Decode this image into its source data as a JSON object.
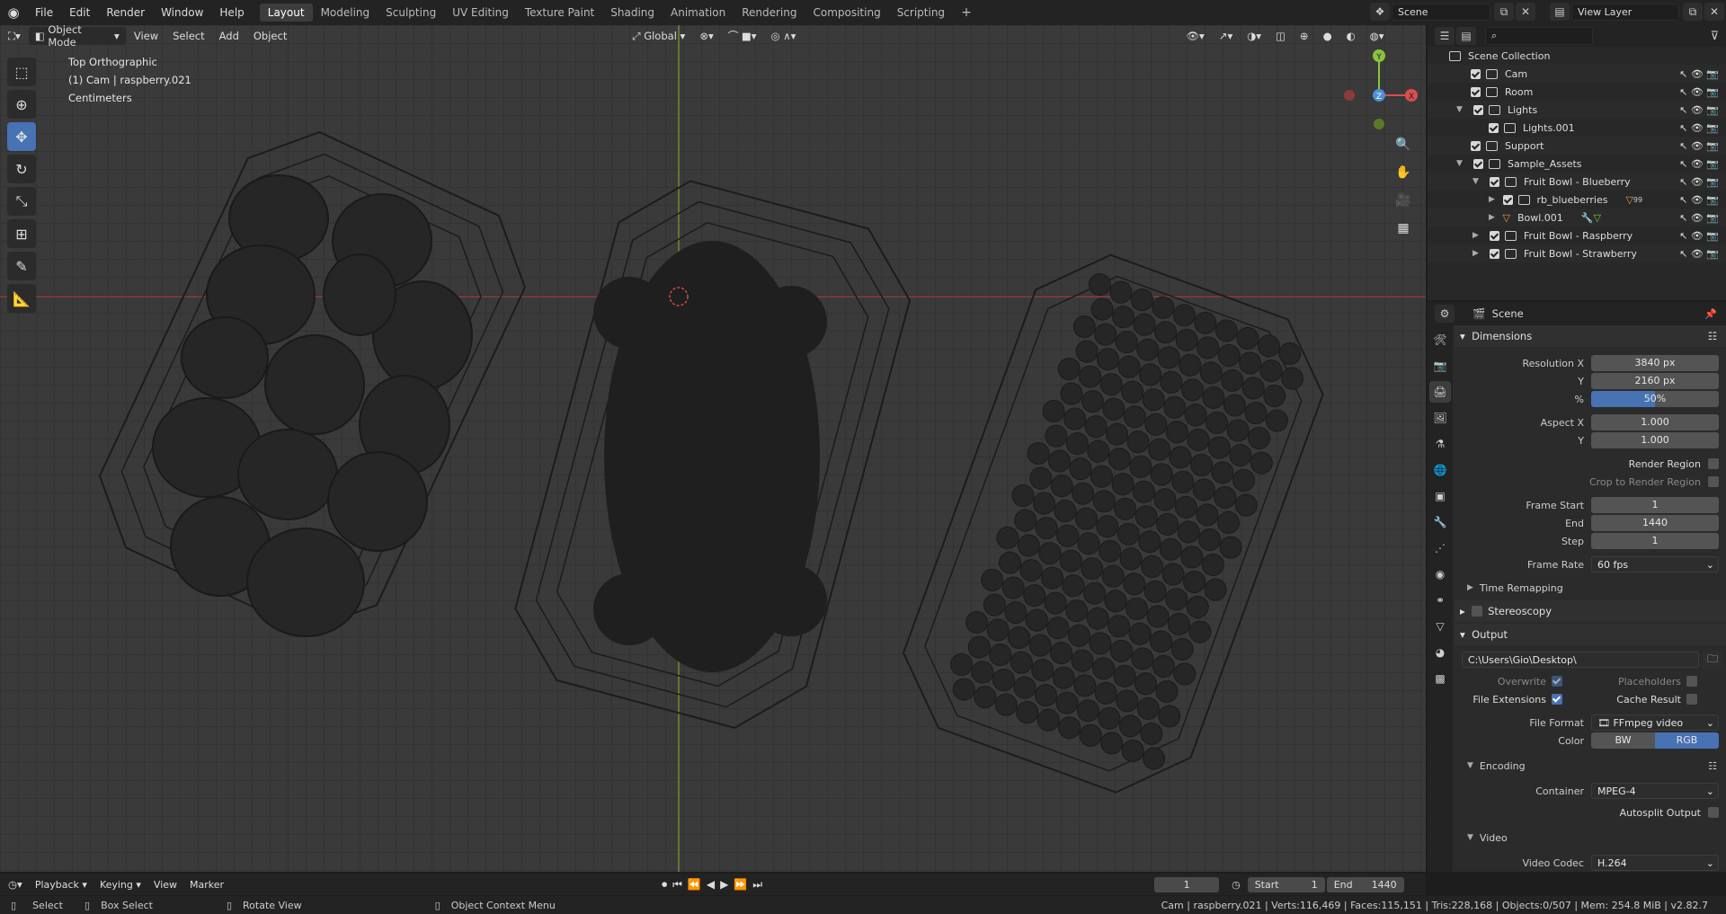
{
  "menu": [
    "File",
    "Edit",
    "Render",
    "Window",
    "Help"
  ],
  "workspaces": [
    "Layout",
    "Modeling",
    "Sculpting",
    "UV Editing",
    "Texture Paint",
    "Shading",
    "Animation",
    "Rendering",
    "Compositing",
    "Scripting"
  ],
  "scene_name": "Scene",
  "view_layer": "View Layer",
  "viewport": {
    "mode": "Object Mode",
    "menus": [
      "View",
      "Select",
      "Add",
      "Object"
    ],
    "transform_orientation": "Global",
    "info": [
      "Top Orthographic",
      "(1) Cam | raspberry.021",
      "Centimeters"
    ]
  },
  "gizmo": {
    "y": "Y",
    "x": "X",
    "z": "Z"
  },
  "outliner": {
    "rows": [
      {
        "label": "Scene Collection"
      },
      {
        "label": "Cam"
      },
      {
        "label": "Room"
      },
      {
        "label": "Lights"
      },
      {
        "label": "Lights.001"
      },
      {
        "label": "Support"
      },
      {
        "label": "Sample_Assets"
      },
      {
        "label": "Fruit Bowl - Blueberry"
      },
      {
        "label": "rb_blueberries"
      },
      {
        "label": "Bowl.001"
      },
      {
        "label": "Fruit Bowl - Raspberry"
      },
      {
        "label": "Fruit Bowl - Strawberry"
      }
    ],
    "badge": "99"
  },
  "properties": {
    "context": "Scene",
    "dimensions": "Dimensions",
    "resolution_x_label": "Resolution X",
    "resolution_x": "3840 px",
    "y_label": "Y",
    "resolution_y": "2160 px",
    "pct_label": "%",
    "resolution_pct": "50%",
    "resolution_pct_value": 0.5,
    "aspect_x_label": "Aspect X",
    "aspect_x": "1.000",
    "aspect_y": "1.000",
    "render_region": "Render Region",
    "crop": "Crop to Render Region",
    "frame_start_label": "Frame Start",
    "frame_start": "1",
    "end_label": "End",
    "frame_end": "1440",
    "step_label": "Step",
    "frame_step": "1",
    "frame_rate_label": "Frame Rate",
    "frame_rate": "60 fps",
    "time_remapping": "Time Remapping",
    "stereoscopy": "Stereoscopy",
    "output": "Output",
    "output_path": "C:\\Users\\Gio\\Desktop\\",
    "overwrite": "Overwrite",
    "placeholders": "Placeholders",
    "file_extensions": "File Extensions",
    "cache_result": "Cache Result",
    "file_format_label": "File Format",
    "file_format": "FFmpeg video",
    "color_label": "Color",
    "color_bw": "BW",
    "color_rgb": "RGB",
    "encoding": "Encoding",
    "container_label": "Container",
    "container": "MPEG-4",
    "autosplit": "Autosplit Output",
    "video": "Video",
    "video_codec_label": "Video Codec",
    "video_codec": "H.264"
  },
  "timeline": {
    "menus": [
      "Playback",
      "Keying",
      "View",
      "Marker"
    ],
    "current": "1",
    "start_label": "Start",
    "start": "1",
    "end_label": "End",
    "end": "1440"
  },
  "status": {
    "select": "Select",
    "box_select": "Box Select",
    "rotate": "Rotate View",
    "context": "Object Context Menu",
    "stats": "Cam | raspberry.021 | Verts:116,469 | Faces:115,151 | Tris:228,168 | Objects:0/507 | Mem: 254.8 MiB | v2.82.7"
  },
  "colors": {
    "accent": "#4772b3",
    "x_axis": "#d94e4e",
    "y_axis": "#8ac43f",
    "z_axis": "#4f8fd6"
  }
}
